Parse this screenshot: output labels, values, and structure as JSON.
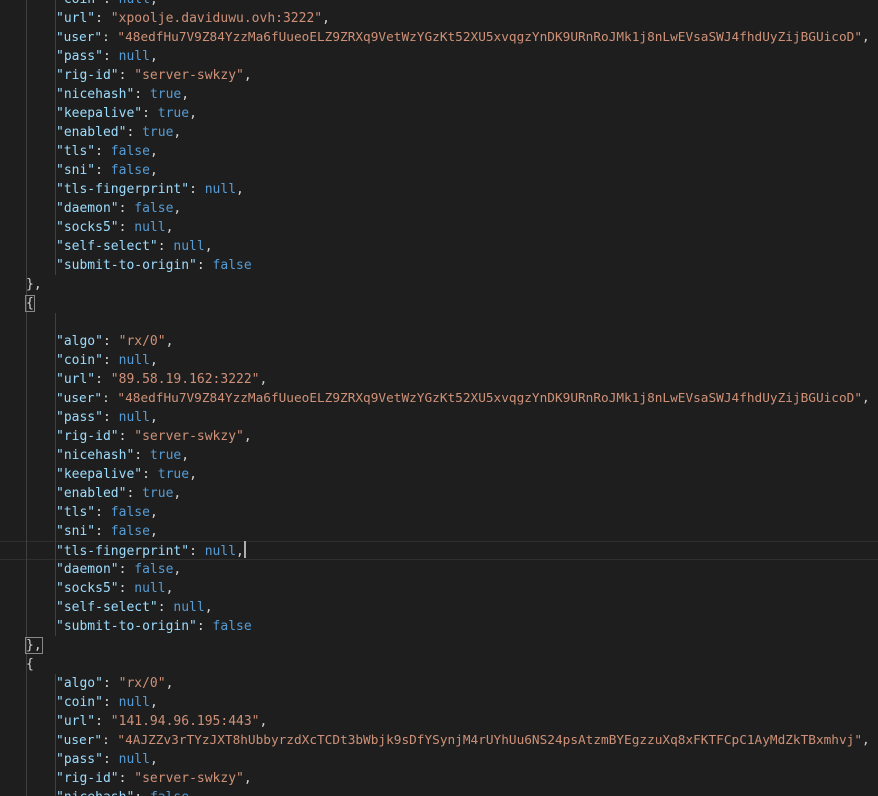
{
  "editor": {
    "lines": [
      {
        "type": "prop",
        "key": "\"coin\"",
        "value": "null",
        "vtype": "b",
        "comma": true
      },
      {
        "type": "prop",
        "key": "\"url\"",
        "value": "\"xpoolje.daviduwu.ovh:3222\"",
        "vtype": "s",
        "comma": true
      },
      {
        "type": "prop",
        "key": "\"user\"",
        "value": "\"48edfHu7V9Z84YzzMa6fUueoELZ9ZRXq9VetWzYGzKt52XU5xvqgzYnDK9URnRoJMk1j8nLwEVsaSWJ4fhdUyZijBGUicoD\"",
        "vtype": "s",
        "comma": true
      },
      {
        "type": "prop",
        "key": "\"pass\"",
        "value": "null",
        "vtype": "b",
        "comma": true
      },
      {
        "type": "prop",
        "key": "\"rig-id\"",
        "value": "\"server-swkzy\"",
        "vtype": "s",
        "comma": true
      },
      {
        "type": "prop",
        "key": "\"nicehash\"",
        "value": "true",
        "vtype": "b",
        "comma": true
      },
      {
        "type": "prop",
        "key": "\"keepalive\"",
        "value": "true",
        "vtype": "b",
        "comma": true
      },
      {
        "type": "prop",
        "key": "\"enabled\"",
        "value": "true",
        "vtype": "b",
        "comma": true
      },
      {
        "type": "prop",
        "key": "\"tls\"",
        "value": "false",
        "vtype": "b",
        "comma": true
      },
      {
        "type": "prop",
        "key": "\"sni\"",
        "value": "false",
        "vtype": "b",
        "comma": true
      },
      {
        "type": "prop",
        "key": "\"tls-fingerprint\"",
        "value": "null",
        "vtype": "b",
        "comma": true
      },
      {
        "type": "prop",
        "key": "\"daemon\"",
        "value": "false",
        "vtype": "b",
        "comma": true
      },
      {
        "type": "prop",
        "key": "\"socks5\"",
        "value": "null",
        "vtype": "b",
        "comma": true
      },
      {
        "type": "prop",
        "key": "\"self-select\"",
        "value": "null",
        "vtype": "b",
        "comma": true
      },
      {
        "type": "prop",
        "key": "\"submit-to-origin\"",
        "value": "false",
        "vtype": "b",
        "comma": false
      },
      {
        "type": "close",
        "text": "},"
      },
      {
        "type": "open",
        "text": "{",
        "highlight": true
      },
      {
        "type": "blank"
      },
      {
        "type": "prop",
        "key": "\"algo\"",
        "value": "\"rx/0\"",
        "vtype": "s",
        "comma": true
      },
      {
        "type": "prop",
        "key": "\"coin\"",
        "value": "null",
        "vtype": "b",
        "comma": true
      },
      {
        "type": "prop",
        "key": "\"url\"",
        "value": "\"89.58.19.162:3222\"",
        "vtype": "s",
        "comma": true
      },
      {
        "type": "prop",
        "key": "\"user\"",
        "value": "\"48edfHu7V9Z84YzzMa6fUueoELZ9ZRXq9VetWzYGzKt52XU5xvqgzYnDK9URnRoJMk1j8nLwEVsaSWJ4fhdUyZijBGUicoD\"",
        "vtype": "s",
        "comma": true
      },
      {
        "type": "prop",
        "key": "\"pass\"",
        "value": "null",
        "vtype": "b",
        "comma": true
      },
      {
        "type": "prop",
        "key": "\"rig-id\"",
        "value": "\"server-swkzy\"",
        "vtype": "s",
        "comma": true
      },
      {
        "type": "prop",
        "key": "\"nicehash\"",
        "value": "true",
        "vtype": "b",
        "comma": true
      },
      {
        "type": "prop",
        "key": "\"keepalive\"",
        "value": "true",
        "vtype": "b",
        "comma": true
      },
      {
        "type": "prop",
        "key": "\"enabled\"",
        "value": "true",
        "vtype": "b",
        "comma": true
      },
      {
        "type": "prop",
        "key": "\"tls\"",
        "value": "false",
        "vtype": "b",
        "comma": true
      },
      {
        "type": "prop",
        "key": "\"sni\"",
        "value": "false",
        "vtype": "b",
        "comma": true
      },
      {
        "type": "prop",
        "key": "\"tls-fingerprint\"",
        "value": "null",
        "vtype": "b",
        "comma": true,
        "cursor": true
      },
      {
        "type": "prop",
        "key": "\"daemon\"",
        "value": "false",
        "vtype": "b",
        "comma": true
      },
      {
        "type": "prop",
        "key": "\"socks5\"",
        "value": "null",
        "vtype": "b",
        "comma": true
      },
      {
        "type": "prop",
        "key": "\"self-select\"",
        "value": "null",
        "vtype": "b",
        "comma": true
      },
      {
        "type": "prop",
        "key": "\"submit-to-origin\"",
        "value": "false",
        "vtype": "b",
        "comma": false
      },
      {
        "type": "close",
        "text": "},",
        "highlight": true
      },
      {
        "type": "open",
        "text": "{"
      },
      {
        "type": "prop",
        "key": "\"algo\"",
        "value": "\"rx/0\"",
        "vtype": "s",
        "comma": true
      },
      {
        "type": "prop",
        "key": "\"coin\"",
        "value": "null",
        "vtype": "b",
        "comma": true
      },
      {
        "type": "prop",
        "key": "\"url\"",
        "value": "\"141.94.96.195:443\"",
        "vtype": "s",
        "comma": true
      },
      {
        "type": "prop",
        "key": "\"user\"",
        "value": "\"4AJZZv3rTYzJXT8hUbbyrzdXcTCDt3bWbjk9sDfYSynjM4rUYhUu6NS24psAtzmBYEgzzuXq8xFKTFCpC1AyMdZkTBxmhvj\"",
        "vtype": "s",
        "comma": true
      },
      {
        "type": "prop",
        "key": "\"pass\"",
        "value": "null",
        "vtype": "b",
        "comma": true
      },
      {
        "type": "prop",
        "key": "\"rig-id\"",
        "value": "\"server-swkzy\"",
        "vtype": "s",
        "comma": true
      },
      {
        "type": "prop",
        "key": "\"nicehash\"",
        "value": "false",
        "vtype": "b",
        "comma": true
      },
      {
        "type": "prop",
        "key": "\"keepalive\"",
        "value": "true",
        "vtype": "b",
        "comma": true
      }
    ]
  }
}
